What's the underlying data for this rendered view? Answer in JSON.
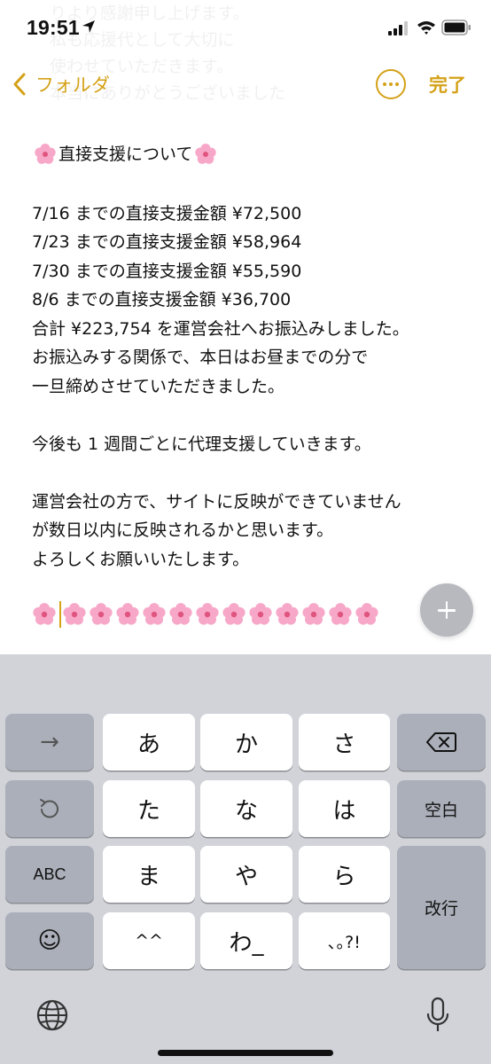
{
  "status_bar": {
    "time": "19:51"
  },
  "ghost_text": [
    "りより感謝申し上げます。",
    "私も応援代として大切に",
    "使わせていただきます。",
    "本当にありがとうございました"
  ],
  "nav": {
    "back_label": "フォルダ",
    "done_label": "完了",
    "accent_color": "#d4a117"
  },
  "note": {
    "title": "直接支援について",
    "lines": [
      "7/16 までの直接支援金額 ¥72,500",
      "7/23 までの直接支援金額 ¥58,964",
      "7/30 までの直接支援金額 ¥55,590",
      "8/6  までの直接支援金額 ¥36,700",
      "合計 ¥223,754 を運営会社へお振込みしました。",
      "お振込みする関係で、本日はお昼までの分で",
      "一旦締めさせていただきました。",
      "",
      "今後も 1 週間ごとに代理支援していきます。",
      "",
      "運営会社の方で、サイトに反映ができていません",
      "が数日以内に反映されるかと思います。",
      "よろしくお願いいたします。"
    ],
    "flower_emoji": "cherry-blossom",
    "flower_row_count": 13
  },
  "keyboard": {
    "arrow_key": "→",
    "row1": [
      "あ",
      "か",
      "さ"
    ],
    "row2": [
      "た",
      "な",
      "は"
    ],
    "row3": [
      "ま",
      "や",
      "ら"
    ],
    "row4": [
      "^^",
      "わ_",
      "､｡?!"
    ],
    "abc_label": "ABC",
    "space_label": "空白",
    "return_label": "改行",
    "emoji_key": "☺"
  }
}
